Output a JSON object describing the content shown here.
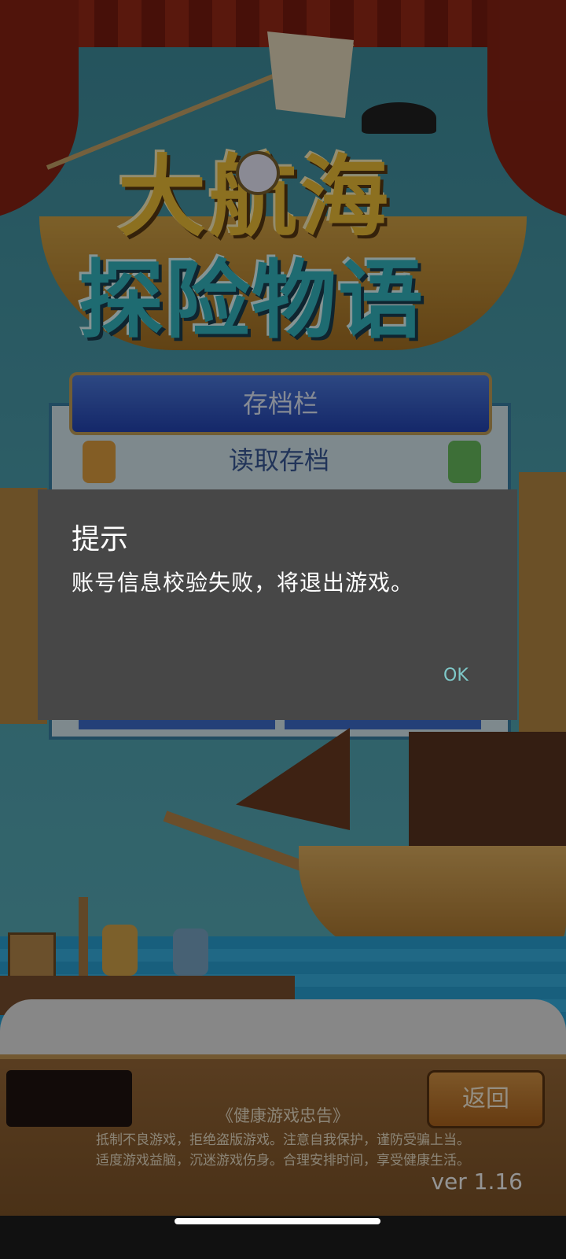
{
  "game": {
    "logo_line1": "大航海",
    "logo_line2": "探险物语"
  },
  "save_panel": {
    "header": "存档栏",
    "load_label": "读取存档"
  },
  "dialog": {
    "title": "提示",
    "message": "账号信息校验失败，将退出游戏。",
    "ok_label": "OK"
  },
  "footer": {
    "back_label": "返回",
    "notice_title": "《健康游戏忠告》",
    "notice_line1": "抵制不良游戏，拒绝盗版游戏。注意自我保护，谨防受骗上当。",
    "notice_line2": "适度游戏益脑，沉迷游戏伤身。合理安排时间，享受健康生活。",
    "version": "ver 1.16"
  },
  "colors": {
    "dialog_bg": "#474747",
    "ok_accent": "#7fc9c9",
    "panel_header": "#2445b6"
  }
}
